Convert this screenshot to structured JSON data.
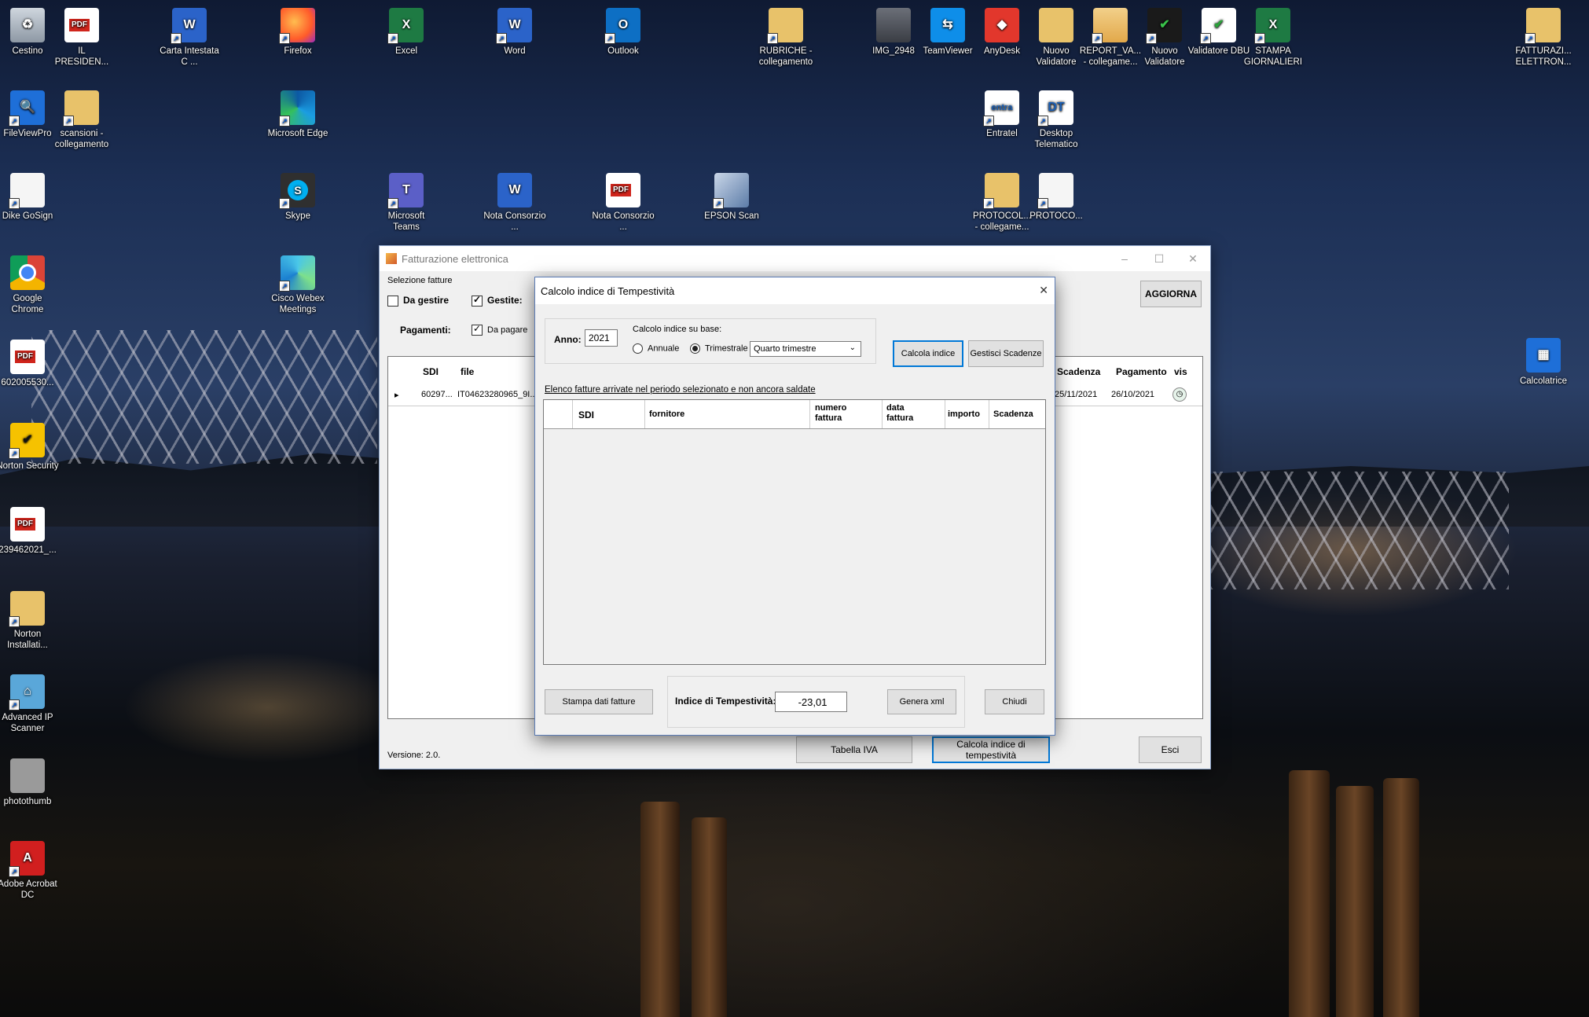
{
  "desktop": {
    "icons_left": [
      {
        "label": "Cestino",
        "icon": "recycle-bin-icon"
      },
      {
        "label": "FileViewPro",
        "icon": "fileviewpro-icon"
      },
      {
        "label": "Dike GoSign",
        "icon": "document-icon"
      },
      {
        "label": "Google Chrome",
        "icon": "chrome-icon"
      },
      {
        "label": "602005530...",
        "icon": "pdf-icon"
      },
      {
        "label": "Norton Security",
        "icon": "norton-icon"
      },
      {
        "label": "239462021_...",
        "icon": "pdf-icon"
      },
      {
        "label": "Norton Installati...",
        "icon": "folder-icon"
      },
      {
        "label": "Advanced IP Scanner",
        "icon": "network-scanner-icon"
      },
      {
        "label": "photothumb",
        "icon": "photothumb-icon"
      },
      {
        "label": "Adobe Acrobat DC",
        "icon": "acrobat-icon"
      }
    ],
    "icons_col2": [
      {
        "label": "IL PRESIDEN...",
        "icon": "pdf-icon"
      },
      {
        "label": "scansioni - collegamento",
        "icon": "folder-icon"
      }
    ],
    "icons_col3": [
      {
        "label": "Carta Intestata C ...",
        "icon": "word-icon"
      }
    ],
    "icons_col4": [
      {
        "label": "Firefox",
        "icon": "firefox-icon"
      },
      {
        "label": "Microsoft Edge",
        "icon": "edge-icon"
      },
      {
        "label": "Skype",
        "icon": "skype-icon"
      },
      {
        "label": "Cisco Webex Meetings",
        "icon": "webex-icon"
      }
    ],
    "icons_top": [
      {
        "label": "Excel",
        "icon": "excel-icon"
      },
      {
        "label": "Word",
        "icon": "word-icon"
      },
      {
        "label": "Outlook",
        "icon": "outlook-icon"
      },
      {
        "label": "RUBRICHE - collegamento",
        "icon": "folder-icon"
      },
      {
        "label": "IMG_2948",
        "icon": "image-icon"
      },
      {
        "label": "TeamViewer",
        "icon": "teamviewer-icon"
      },
      {
        "label": "AnyDesk",
        "icon": "anydesk-icon"
      },
      {
        "label": "Nuovo Validatore",
        "icon": "folder-icon"
      },
      {
        "label": "REPORT_VA... - collegame...",
        "icon": "folder-pdf-icon"
      },
      {
        "label": "Nuovo Validatore",
        "icon": "validator-icon"
      },
      {
        "label": "Validatore DBU",
        "icon": "validator-dbu-icon"
      },
      {
        "label": "STAMPA GIORNALIERI",
        "icon": "excel-icon"
      },
      {
        "label": "FATTURAZI... ELETTRON...",
        "icon": "folder-icon"
      }
    ],
    "icons_row3": [
      {
        "label": "Microsoft Teams",
        "icon": "teams-icon"
      },
      {
        "label": "Nota Consorzio ...",
        "icon": "word-icon"
      },
      {
        "label": "Nota Consorzio ...",
        "icon": "pdf-icon"
      },
      {
        "label": "EPSON Scan",
        "icon": "scanner-icon"
      },
      {
        "label": "PROTOCOL... - collegame...",
        "icon": "folder-icon"
      },
      {
        "label": "PROTOCO...",
        "icon": "document-icon"
      }
    ],
    "icons_row2_right": [
      {
        "label": "Entratel",
        "icon": "entratel-icon"
      },
      {
        "label": "Desktop Telematico",
        "icon": "desktop-telematico-icon"
      }
    ],
    "calc": {
      "label": "Calcolatrice",
      "icon": "calculator-icon"
    }
  },
  "main_window": {
    "title": "Fatturazione elettronica",
    "selezione_label": "Selezione fatture",
    "da_gestire": "Da gestire",
    "gestite": "Gestite:",
    "pagamenti": "Pagamenti:",
    "da_pagare": "Da pagare",
    "aggiorna": "AGGIORNA",
    "columns": {
      "sdi": "SDI",
      "file": "file",
      "scadenza": "Scadenza",
      "pagamento": "Pagamento",
      "vis": "vis"
    },
    "row": {
      "sdi": "60297...",
      "file": "IT04623280965_9I...",
      "scadenza": "25/11/2021",
      "pagamento": "26/10/2021"
    },
    "version": "Versione: 2.0.",
    "tabella_iva": "Tabella IVA",
    "calcola_tempestivita": "Calcola indice di tempestività",
    "esci": "Esci"
  },
  "dialog": {
    "title": "Calcolo indice di Tempestività",
    "anno_label": "Anno:",
    "anno_value": "2021",
    "base_label": "Calcolo indice su base:",
    "annuale": "Annuale",
    "trimestrale": "Trimestrale",
    "periodo_selected": "Quarto trimestre",
    "calcola_indice": "Calcola indice",
    "gestisci_scadenze": "Gestisci Scadenze",
    "list_caption": "Elenco fatture arrivate nel periodo selezionato e non ancora saldate",
    "columns": {
      "sdi": "SDI",
      "fornitore": "fornitore",
      "numero": "numero fattura",
      "data": "data fattura",
      "importo": "importo",
      "scadenza": "Scadenza"
    },
    "stampa": "Stampa dati fatture",
    "indice_label": "Indice di Tempestività:",
    "indice_value": "-23,01",
    "genera_xml": "Genera xml",
    "chiudi": "Chiudi"
  }
}
